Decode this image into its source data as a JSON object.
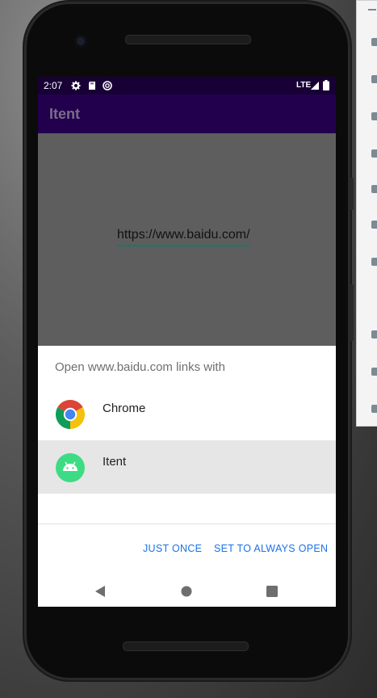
{
  "status_bar": {
    "time": "2:07",
    "network": "LTE"
  },
  "app_bar": {
    "title": "Itent"
  },
  "content": {
    "url_value": "https://www.baidu.com/"
  },
  "chooser": {
    "title": "Open www.baidu.com links with",
    "apps": [
      {
        "label": "Chrome",
        "icon": "chrome-icon",
        "selected": false
      },
      {
        "label": "Itent",
        "icon": "android-app-icon",
        "selected": true
      }
    ],
    "actions": {
      "just_once": "JUST ONCE",
      "always": "SET TO ALWAYS OPEN"
    },
    "accent_color": "#1a73e8"
  },
  "nav_bar": {
    "icons": [
      "back-icon",
      "home-icon",
      "recents-icon"
    ]
  },
  "colors": {
    "status_bar": "#180036",
    "app_bar": "#23004d",
    "scrim": "#5e5e5e",
    "selected_row": "#e6e6e6"
  }
}
